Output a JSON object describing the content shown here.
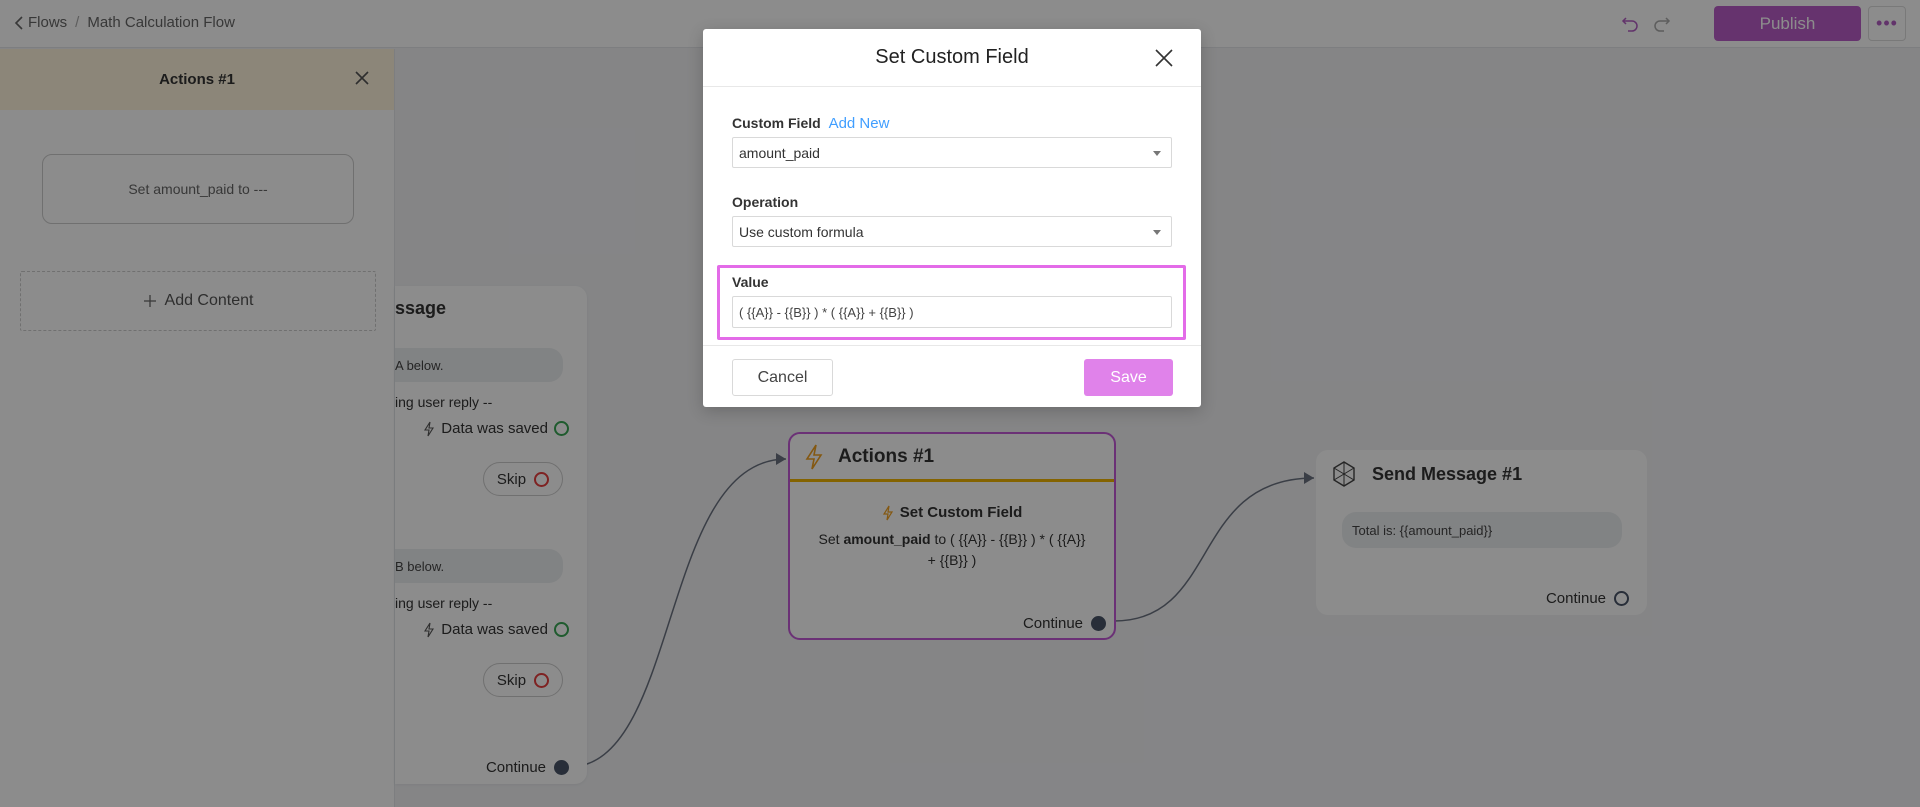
{
  "topbar": {
    "back_label": "Flows",
    "separator": "/",
    "flow_name": "Math Calculation Flow",
    "publish_label": "Publish",
    "more_label": "•••"
  },
  "sidebar": {
    "title": "Actions #1",
    "item_text": "Set amount_paid to ---",
    "add_content_label": "Add Content"
  },
  "canvas": {
    "node1": {
      "title": "ssage",
      "bubble1": "A below.",
      "waiting1": "ing user reply --",
      "saved1": "Data was saved",
      "skip1": "Skip",
      "bubble2": "B below.",
      "waiting2": "ing user reply --",
      "saved2": "Data was saved",
      "skip2": "Skip",
      "continue": "Continue"
    },
    "actions_node": {
      "title": "Actions #1",
      "subtitle": "Set Custom Field",
      "desc_prefix": "Set ",
      "desc_field": "amount_paid",
      "desc_suffix": " to ( {{A}} - {{B}} ) * ( {{A}} + {{B}} )",
      "continue": "Continue"
    },
    "send_node": {
      "title": "Send Message #1",
      "message": "Total is: {{amount_paid}}",
      "continue": "Continue"
    }
  },
  "modal": {
    "title": "Set Custom Field",
    "custom_field_label": "Custom Field",
    "add_new_label": "Add New",
    "custom_field_value": "amount_paid",
    "operation_label": "Operation",
    "operation_value": "Use custom formula",
    "value_label": "Value",
    "value_text": "( {{A}} - {{B}} ) * ( {{A}} + {{B}} )",
    "cancel_label": "Cancel",
    "save_label": "Save"
  },
  "colors": {
    "accent": "#bb5ec8",
    "highlight": "#e36be8",
    "save": "#e082ea",
    "link": "#409eff",
    "warning_bar": "#f0b400"
  }
}
